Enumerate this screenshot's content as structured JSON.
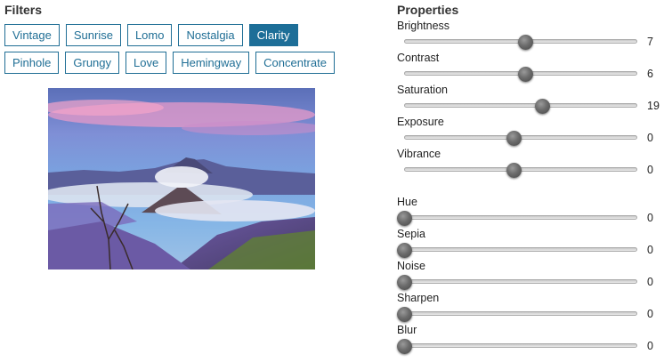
{
  "filters": {
    "heading": "Filters",
    "row1": [
      {
        "label": "Vintage",
        "active": false
      },
      {
        "label": "Sunrise",
        "active": false
      },
      {
        "label": "Lomo",
        "active": false
      },
      {
        "label": "Nostalgia",
        "active": false
      },
      {
        "label": "Clarity",
        "active": true
      }
    ],
    "row2": [
      {
        "label": "Pinhole",
        "active": false
      },
      {
        "label": "Grungy",
        "active": false
      },
      {
        "label": "Love",
        "active": false
      },
      {
        "label": "Hemingway",
        "active": false
      },
      {
        "label": "Concentrate",
        "active": false
      }
    ]
  },
  "properties": {
    "heading": "Properties",
    "sliders": [
      {
        "label": "Brightness",
        "value": "7",
        "fraction": 0.52
      },
      {
        "label": "Contrast",
        "value": "6",
        "fraction": 0.52
      },
      {
        "label": "Saturation",
        "value": "19",
        "fraction": 0.59
      },
      {
        "label": "Exposure",
        "value": "0",
        "fraction": 0.47
      },
      {
        "label": "Vibrance",
        "value": "0",
        "fraction": 0.47
      },
      {
        "label": "Hue",
        "value": "0",
        "fraction": 0.0
      },
      {
        "label": "Sepia",
        "value": "0",
        "fraction": 0.0
      },
      {
        "label": "Noise",
        "value": "0",
        "fraction": 0.0
      },
      {
        "label": "Sharpen",
        "value": "0",
        "fraction": 0.0
      },
      {
        "label": "Blur",
        "value": "0",
        "fraction": 0.0
      }
    ]
  },
  "colors": {
    "accent": "#1d6e98",
    "active_text": "#ffffff"
  },
  "icons": {
    "thumb": "slider-thumb-icon"
  }
}
